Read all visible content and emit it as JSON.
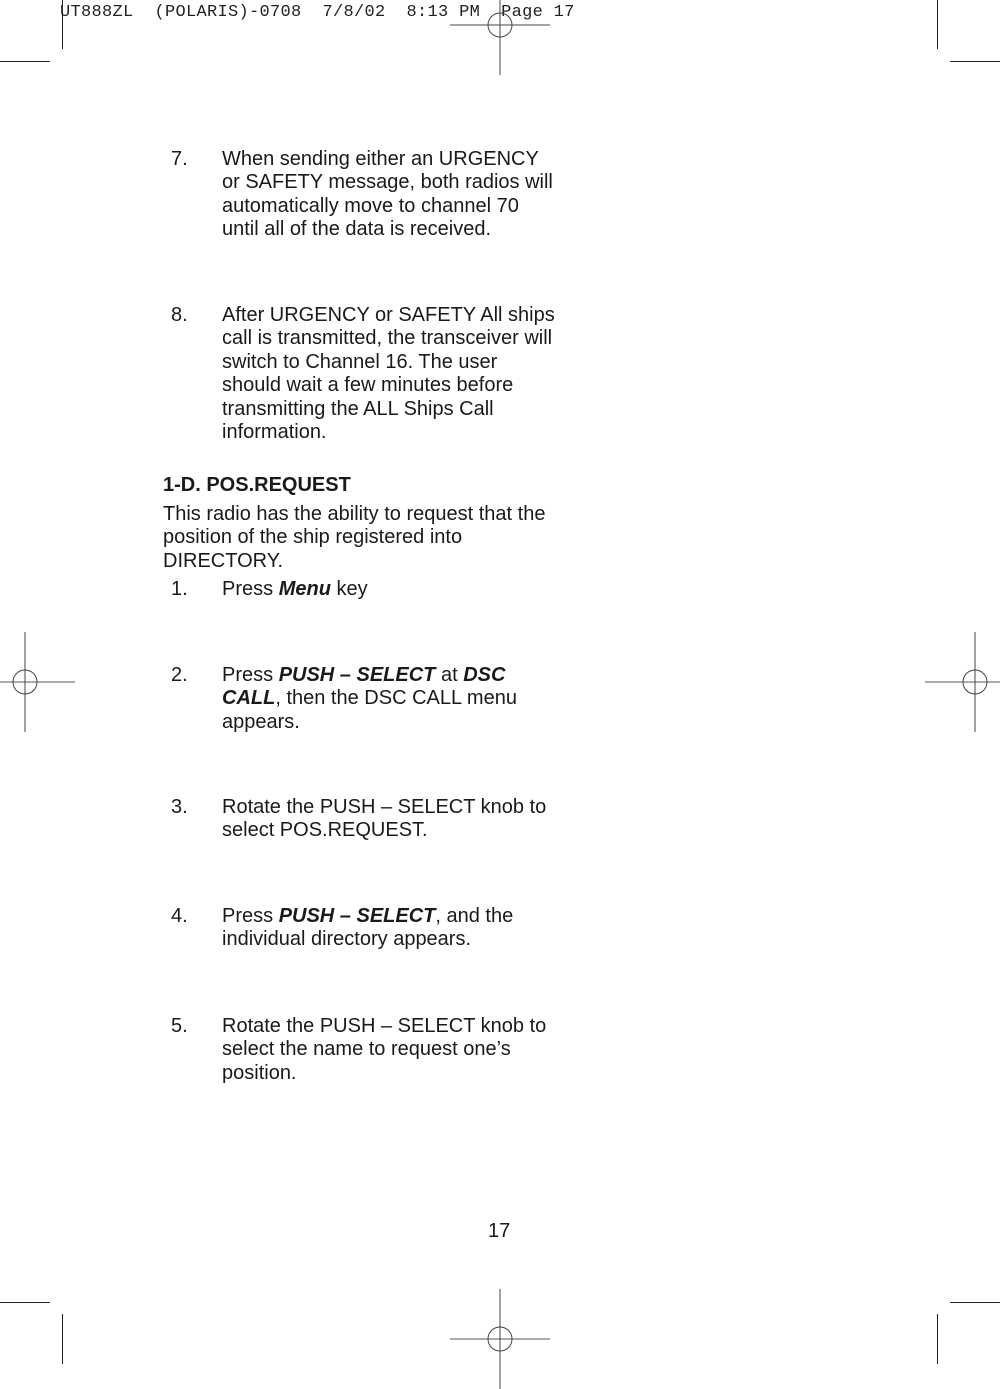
{
  "slug": "UT888ZL  (POLARIS)-0708  7/8/02  8:13 PM  Page 17",
  "items_top": [
    {
      "num": "7.",
      "lines": [
        "When sending either an URGENCY",
        "or SAFETY message, both radios will",
        "automatically move to channel 70",
        "until all of the data is received."
      ]
    },
    {
      "num": "8.",
      "lines": [
        "After URGENCY or SAFETY All ships",
        "call is transmitted, the transceiver will",
        "switch to Channel 16. The user",
        "should wait a few minutes before",
        "transmitting the ALL Ships Call",
        "information."
      ]
    }
  ],
  "section": {
    "heading": "1-D. POS.REQUEST",
    "intro_lines": [
      "This radio has the ability to request that the",
      "position of the ship registered into",
      "DIRECTORY."
    ],
    "steps": [
      {
        "num": "1.",
        "pre": "Press ",
        "bold": "Menu",
        "post": " key"
      },
      {
        "num": "2.",
        "line1_pre": "Press ",
        "line1_bold1": "PUSH – SELECT",
        "line1_mid": " at ",
        "line1_bold2": "DSC",
        "line2_bold": "CALL",
        "line2_post": ", then the DSC CALL menu",
        "line3": "appears."
      },
      {
        "num": "3.",
        "lines": [
          "Rotate the PUSH – SELECT knob to",
          "select POS.REQUEST."
        ]
      },
      {
        "num": "4.",
        "line1_pre": "Press ",
        "line1_bold": "PUSH – SELECT",
        "line1_post": ", and the",
        "line2": "individual directory appears."
      },
      {
        "num": "5.",
        "lines": [
          "Rotate the PUSH – SELECT knob to",
          "select the name to request one’s",
          "position."
        ]
      }
    ]
  },
  "page_number": "17"
}
